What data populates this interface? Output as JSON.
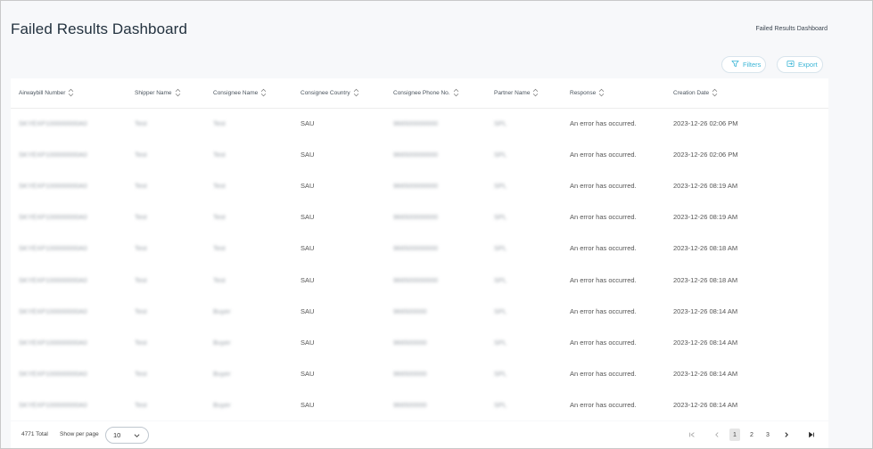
{
  "header": {
    "title": "Failed Results Dashboard",
    "breadcrumb": "Failed Results Dashboard"
  },
  "actions": {
    "filters_label": "Filters",
    "export_label": "Export"
  },
  "table": {
    "columns": [
      "Airwaybill Number",
      "Shipper Name",
      "Consignee Name",
      "Consignee Country",
      "Consignee Phone No.",
      "Partner Name",
      "Response",
      "Creation Date"
    ],
    "rows": [
      [
        "SKYEXP100000000A0",
        "Test",
        "Test",
        "SAU",
        "966500000000",
        "SPL",
        "An error has occurred.",
        "2023-12-26 02:06 PM"
      ],
      [
        "SKYEXP100000000A0",
        "Test",
        "Test",
        "SAU",
        "966500000000",
        "SPL",
        "An error has occurred.",
        "2023-12-26 02:06 PM"
      ],
      [
        "SKYEXP100000000A0",
        "Test",
        "Test",
        "SAU",
        "966500000000",
        "SPL",
        "An error has occurred.",
        "2023-12-26 08:19 AM"
      ],
      [
        "SKYEXP100000000A0",
        "Test",
        "Test",
        "SAU",
        "966500000000",
        "SPL",
        "An error has occurred.",
        "2023-12-26 08:19 AM"
      ],
      [
        "SKYEXP100000000A0",
        "Test",
        "Test",
        "SAU",
        "966500000000",
        "SPL",
        "An error has occurred.",
        "2023-12-26 08:18 AM"
      ],
      [
        "SKYEXP100000000A0",
        "Test",
        "Test",
        "SAU",
        "966500000000",
        "SPL",
        "An error has occurred.",
        "2023-12-26 08:18 AM"
      ],
      [
        "SKYEXP100000000A0",
        "Test",
        "Buyer",
        "SAU",
        "966500000",
        "SPL",
        "An error has occurred.",
        "2023-12-26 08:14 AM"
      ],
      [
        "SKYEXP100000000A0",
        "Test",
        "Buyer",
        "SAU",
        "966500000",
        "SPL",
        "An error has occurred.",
        "2023-12-26 08:14 AM"
      ],
      [
        "SKYEXP100000000A0",
        "Test",
        "Buyer",
        "SAU",
        "966500000",
        "SPL",
        "An error has occurred.",
        "2023-12-26 08:14 AM"
      ],
      [
        "SKYEXP100000000A0",
        "Test",
        "Buyer",
        "SAU",
        "966500000",
        "SPL",
        "An error has occurred.",
        "2023-12-26 08:14 AM"
      ]
    ]
  },
  "footer": {
    "total": "4771 Total",
    "show_per_page_label": "Show per page",
    "per_page_value": "10",
    "pages": [
      "1",
      "2",
      "3"
    ],
    "current_page": "1"
  },
  "colors": {
    "accent": "#3ab5d6",
    "title": "#23323f",
    "background": "#f7f8fa"
  },
  "icons": [
    "filter-icon",
    "export-icon",
    "sort-icon",
    "chevron-down-icon",
    "first-page-icon",
    "prev-page-icon",
    "next-page-icon",
    "last-page-icon"
  ]
}
